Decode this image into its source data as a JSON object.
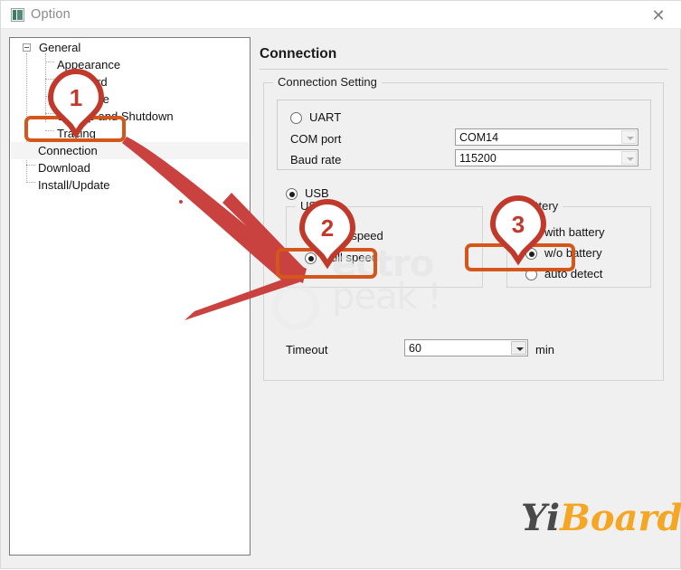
{
  "window": {
    "title": "Option",
    "icon": "app-icon",
    "close_label": "✕"
  },
  "sidebar": {
    "items": [
      {
        "label": "General",
        "level": 0,
        "expander": "minus"
      },
      {
        "label": "Appearance",
        "level": 1
      },
      {
        "label": "Keyboard",
        "level": 1
      },
      {
        "label": "Language",
        "level": 1
      },
      {
        "label": "Startup and Shutdown",
        "level": 1
      },
      {
        "label": "Tracing",
        "level": 1
      },
      {
        "label": "Connection",
        "level": 0,
        "selected": true
      },
      {
        "label": "Download",
        "level": 0
      },
      {
        "label": "Install/Update",
        "level": 0
      }
    ]
  },
  "main": {
    "page_title": "Connection",
    "connection_setting": {
      "group_label": "Connection Setting",
      "uart": {
        "radio_label": "UART",
        "selected": false,
        "com_port": {
          "label": "COM port",
          "value": "COM14",
          "enabled": false
        },
        "baud_rate": {
          "label": "Baud rate",
          "value": "115200",
          "enabled": false
        }
      },
      "usb": {
        "radio_label": "USB",
        "selected": true,
        "speed_group": {
          "group_label": "USB",
          "options": [
            {
              "label": "High speed",
              "selected": false
            },
            {
              "label": "Full speed",
              "selected": true
            }
          ]
        },
        "battery_group": {
          "group_label": "Battery",
          "options": [
            {
              "label": "with battery",
              "selected": false
            },
            {
              "label": "w/o battery",
              "selected": true
            },
            {
              "label": "auto detect",
              "selected": false
            }
          ]
        },
        "timeout": {
          "label": "Timeout",
          "value": "60",
          "unit": "min",
          "enabled": true
        }
      }
    }
  },
  "annotations": {
    "accent_color": "#d4561b",
    "marker_color": "#c0392b",
    "arrow_color": "#c9423f",
    "markers": [
      {
        "id": "1",
        "target": "sidebar-item-connection"
      },
      {
        "id": "2",
        "target": "radio-full-speed"
      },
      {
        "id": "3",
        "target": "radio-wo-battery"
      }
    ]
  },
  "watermarks": {
    "electropeak": {
      "line1": "ectro",
      "line2": "peak !"
    },
    "yiboard": {
      "part1": "Yi",
      "part2": "Board"
    }
  }
}
